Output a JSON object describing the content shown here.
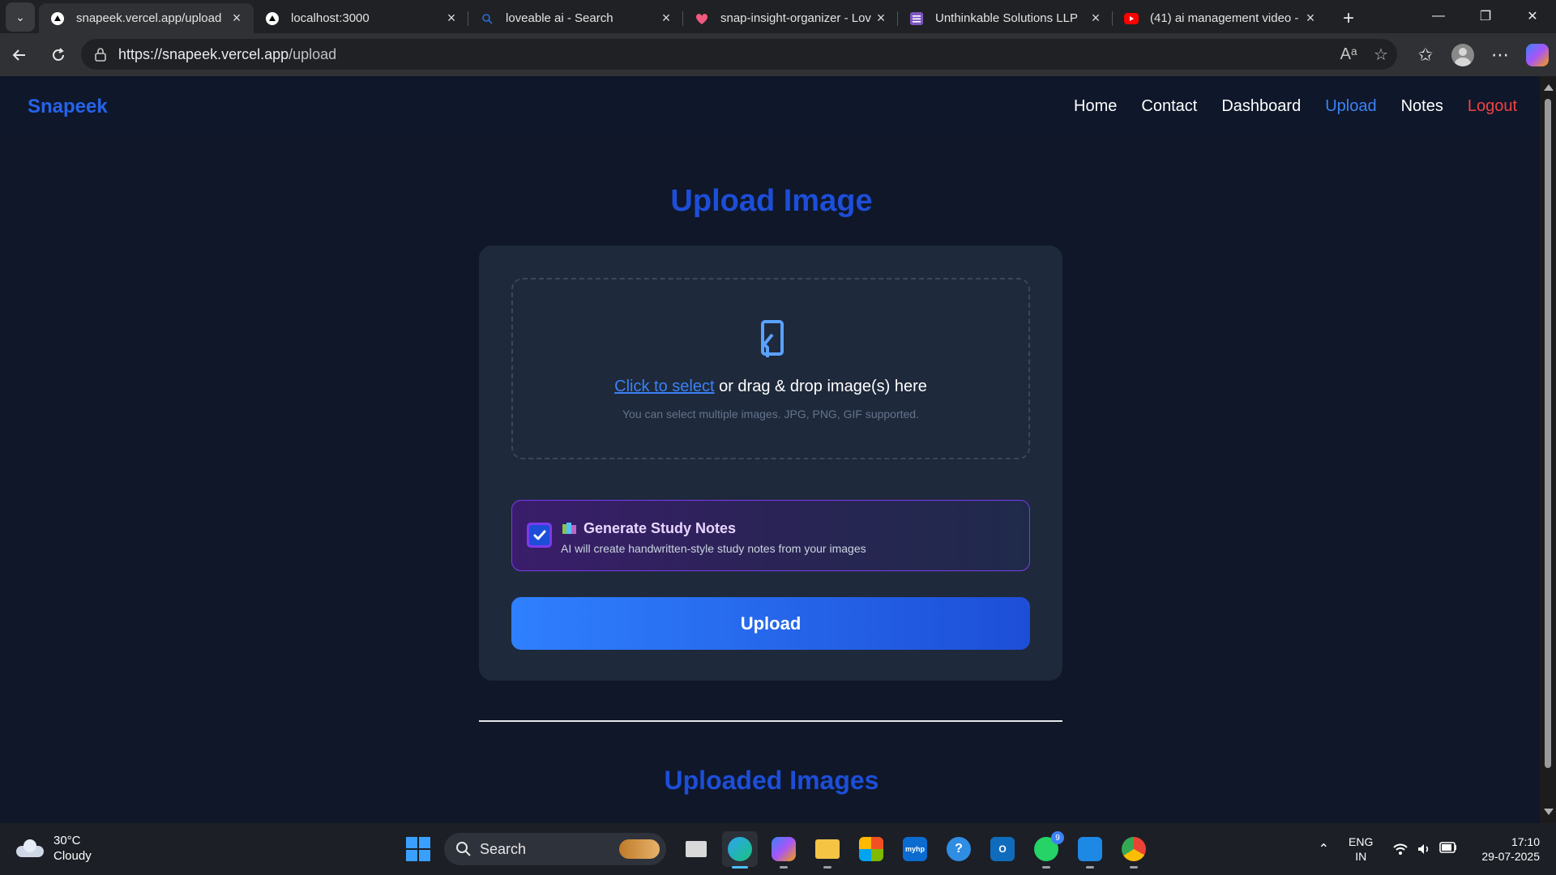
{
  "browser": {
    "tabs": [
      {
        "title": "snapeek.vercel.app/upload",
        "active": true,
        "favicon": "vercel-triangle-icon"
      },
      {
        "title": "localhost:3000",
        "active": false,
        "favicon": "vercel-triangle-icon"
      },
      {
        "title": "loveable ai - Search",
        "active": false,
        "favicon": "search-icon"
      },
      {
        "title": "snap-insight-organizer - Lov",
        "active": false,
        "favicon": "lovable-heart-icon"
      },
      {
        "title": "Unthinkable Solutions LLP",
        "active": false,
        "favicon": "forms-icon"
      },
      {
        "title": "(41) ai management video -",
        "active": false,
        "favicon": "youtube-icon"
      }
    ],
    "url_host": "https://snapeek.vercel.app",
    "url_path": "/upload"
  },
  "site": {
    "brand": "Snapeek",
    "nav": [
      {
        "label": "Home",
        "state": "normal"
      },
      {
        "label": "Contact",
        "state": "normal"
      },
      {
        "label": "Dashboard",
        "state": "normal"
      },
      {
        "label": "Upload",
        "state": "active"
      },
      {
        "label": "Notes",
        "state": "normal"
      },
      {
        "label": "Logout",
        "state": "danger"
      }
    ]
  },
  "upload": {
    "title": "Upload Image",
    "drop_link": "Click to select",
    "drop_text": " or drag & drop image(s) here",
    "drop_hint": "You can select multiple images. JPG, PNG, GIF supported.",
    "notes_title": "Generate Study Notes",
    "notes_desc": "AI will create handwritten-style study notes from your images",
    "notes_checked": true,
    "button_label": "Upload"
  },
  "uploaded": {
    "title": "Uploaded Images"
  },
  "taskbar": {
    "temperature": "30°C",
    "weather": "Cloudy",
    "search_label": "Search",
    "whatsapp_badge": "9",
    "lang_1": "ENG",
    "lang_2": "IN",
    "time": "17:10",
    "date": "29-07-2025"
  },
  "colors": {
    "brand": "#2563eb",
    "nav_active": "#3b82f6",
    "logout": "#ef4444",
    "card_bg": "#1e293b",
    "page_bg": "#0f1729",
    "notes_border": "#7c3aed"
  }
}
